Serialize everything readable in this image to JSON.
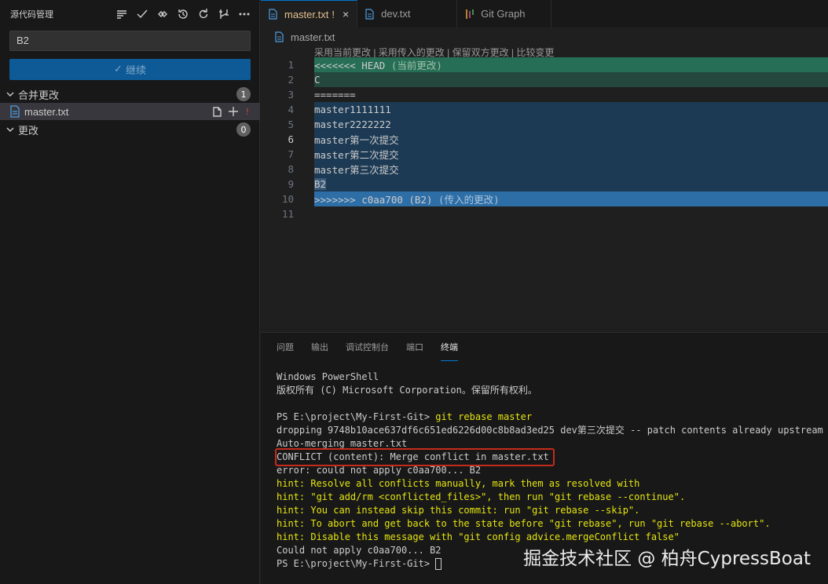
{
  "sidebar": {
    "title": "源代码管理",
    "commit_input_value": "B2",
    "continue_label": "继续",
    "groups": [
      {
        "label": "合并更改",
        "count": "1"
      },
      {
        "label": "更改",
        "count": "0"
      }
    ],
    "file": {
      "name": "master.txt",
      "status": "!"
    }
  },
  "tabs": [
    {
      "label": "master.txt",
      "dirty": "!",
      "close": "×"
    },
    {
      "label": "dev.txt"
    },
    {
      "label": "Git Graph"
    }
  ],
  "breadcrumb": "master.txt",
  "codelens": "采用当前更改 | 采用传入的更改 | 保留双方更改 | 比较变更",
  "editor": {
    "lines": [
      {
        "n": "1",
        "text": "<<<<<<< HEAD",
        "suffix": " (当前更改)"
      },
      {
        "n": "2",
        "text": "C"
      },
      {
        "n": "3",
        "text": "======="
      },
      {
        "n": "4",
        "text": "master1111111"
      },
      {
        "n": "5",
        "text": "master2222222"
      },
      {
        "n": "6",
        "text": "master第一次提交"
      },
      {
        "n": "7",
        "text": "master第二次提交"
      },
      {
        "n": "8",
        "text": "master第三次提交"
      },
      {
        "n": "9",
        "text": "B2"
      },
      {
        "n": "10",
        "text": ">>>>>>> c0aa700 (B2)",
        "suffix": " (传入的更改)"
      },
      {
        "n": "11",
        "text": ""
      }
    ]
  },
  "panel": {
    "tabs": [
      "问题",
      "输出",
      "调试控制台",
      "端口",
      "终端"
    ],
    "terminal": [
      "Windows PowerShell",
      "版权所有 (C) Microsoft Corporation。保留所有权利。",
      "",
      "PS E:\\project\\My-First-Git> ",
      "dropping 9748b10ace637df6c651ed6226d00c8b8ad3ed25 dev第三次提交 -- patch contents already upstream",
      "Auto-merging master.txt",
      "CONFLICT (content): Merge conflict in master.txt",
      "error: could not apply c0aa700... B2",
      "hint: Resolve all conflicts manually, mark them as resolved with",
      "hint: \"git add/rm <conflicted_files>\", then run \"git rebase --continue\".",
      "hint: You can instead skip this commit: run \"git rebase --skip\".",
      "hint: To abort and get back to the state before \"git rebase\", run \"git rebase --abort\".",
      "hint: Disable this message with \"git config advice.mergeConflict false\"",
      "Could not apply c0aa700... B2",
      "PS E:\\project\\My-First-Git> "
    ],
    "command": "git rebase master"
  },
  "watermark": "掘金技术社区 @ 柏舟CypressBoat",
  "colors": {
    "accent": "#0078d4",
    "current_change": "#2b8a6b",
    "incoming_change": "#2e6ea6",
    "hint_yellow": "#e5e510",
    "conflict_red": "#c42b1c"
  }
}
